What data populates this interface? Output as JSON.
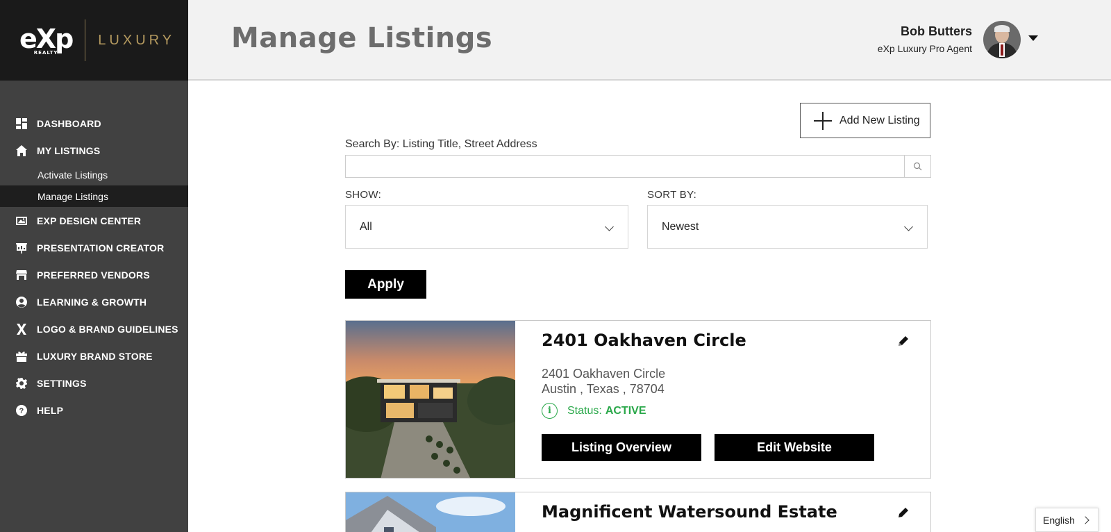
{
  "brand": {
    "exp": "eXp",
    "realty": "REALTY",
    "luxury": "LUXURY",
    "accent_color": "#b59a5f"
  },
  "sidebar": {
    "items": [
      {
        "label": "DASHBOARD",
        "icon": "dashboard-icon"
      },
      {
        "label": "MY LISTINGS",
        "icon": "home-icon"
      },
      {
        "label": "EXP DESIGN CENTER",
        "icon": "image-icon"
      },
      {
        "label": "PRESENTATION CREATOR",
        "icon": "presentation-icon"
      },
      {
        "label": "PREFERRED VENDORS",
        "icon": "store-icon"
      },
      {
        "label": "LEARNING & GROWTH",
        "icon": "user-circle-icon"
      },
      {
        "label": "LOGO & BRAND GUIDELINES",
        "icon": "x-logo-icon"
      },
      {
        "label": "LUXURY BRAND STORE",
        "icon": "gift-icon"
      },
      {
        "label": "SETTINGS",
        "icon": "gear-icon"
      },
      {
        "label": "HELP",
        "icon": "help-icon"
      }
    ],
    "sub_items": [
      {
        "label": "Activate Listings"
      },
      {
        "label": "Manage Listings",
        "active": true
      }
    ]
  },
  "header": {
    "title": "Manage Listings",
    "user_name": "Bob Butters",
    "user_role": "eXp Luxury Pro Agent"
  },
  "toolbar": {
    "add_label": "Add New Listing",
    "search_label": "Search By: Listing Title, Street Address",
    "search_value": "",
    "show_label": "SHOW:",
    "show_value": "All",
    "sort_label": "SORT BY:",
    "sort_value": "Newest",
    "apply_label": "Apply"
  },
  "listings": [
    {
      "title": "2401 Oakhaven Circle",
      "address_line1": "2401 Oakhaven Circle",
      "address_line2": "Austin , Texas , 78704",
      "status_label": "Status:",
      "status_value": "ACTIVE",
      "overview_label": "Listing Overview",
      "website_label": "Edit Website"
    },
    {
      "title": "Magnificent Watersound Estate"
    }
  ],
  "language": {
    "value": "English"
  },
  "colors": {
    "sidebar_bg": "#414141",
    "logo_bg": "#1a1a1a",
    "active_sub_bg": "#1e1e1e",
    "header_bg": "#f2f2f2",
    "status_green": "#2aa84a"
  }
}
